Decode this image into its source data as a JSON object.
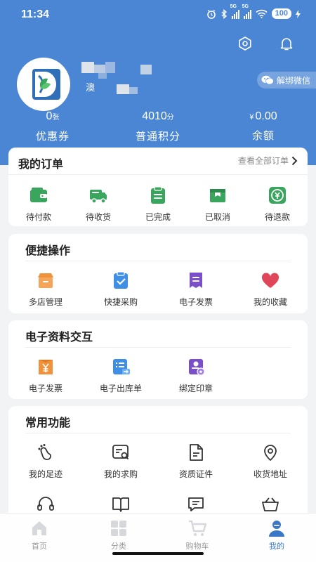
{
  "status_bar": {
    "time": "11:34",
    "battery": "100",
    "signal_1": "5G",
    "signal_2": "5G"
  },
  "header": {
    "avatar_logo_text": "D",
    "username_fragment": "澳",
    "unbind_wechat_label": "解绑微信",
    "icons": {
      "settings": "gear-icon",
      "notifications": "bell-icon"
    }
  },
  "stats": [
    {
      "value": "0",
      "unit": "张",
      "prefix": "",
      "label": "优惠券"
    },
    {
      "value": "4010",
      "unit": "分",
      "prefix": "",
      "label": "普通积分"
    },
    {
      "value": "0.00",
      "unit": "",
      "prefix": "¥",
      "label": "余额"
    }
  ],
  "orders": {
    "title": "我的订单",
    "view_all": "查看全部订单",
    "items": [
      {
        "label": "待付款",
        "icon": "wallet-icon"
      },
      {
        "label": "待收货",
        "icon": "truck-icon"
      },
      {
        "label": "已完成",
        "icon": "clipboard-check-icon"
      },
      {
        "label": "已取消",
        "icon": "cancelled-box-icon"
      },
      {
        "label": "待退款",
        "icon": "refund-icon"
      }
    ]
  },
  "quick_actions": {
    "title": "便捷操作",
    "items": [
      {
        "label": "多店管理",
        "icon": "store-icon"
      },
      {
        "label": "快捷采购",
        "icon": "purchase-check-icon"
      },
      {
        "label": "电子发票",
        "icon": "invoice-icon"
      },
      {
        "label": "我的收藏",
        "icon": "heart-icon"
      }
    ]
  },
  "e_docs": {
    "title": "电子资料交互",
    "items": [
      {
        "label": "电子发票",
        "icon": "yen-invoice-icon"
      },
      {
        "label": "电子出库单",
        "icon": "outbound-list-icon"
      },
      {
        "label": "绑定印章",
        "icon": "seal-icon"
      }
    ]
  },
  "common": {
    "title": "常用功能",
    "items": [
      {
        "label": "我的足迹",
        "icon": "footprint-icon"
      },
      {
        "label": "我的求购",
        "icon": "request-search-icon"
      },
      {
        "label": "资质证件",
        "icon": "certificate-icon"
      },
      {
        "label": "收货地址",
        "icon": "location-pin-icon"
      },
      {
        "label": "",
        "icon": "headset-icon"
      },
      {
        "label": "",
        "icon": "book-icon"
      },
      {
        "label": "",
        "icon": "message-icon"
      },
      {
        "label": "",
        "icon": "basket-icon"
      }
    ]
  },
  "bottom_nav": {
    "items": [
      {
        "label": "首页",
        "icon": "home-icon"
      },
      {
        "label": "分类",
        "icon": "category-grid-icon"
      },
      {
        "label": "购物车",
        "icon": "cart-icon"
      },
      {
        "label": "我的",
        "icon": "user-icon"
      }
    ],
    "active": "我的"
  },
  "colors": {
    "header_bg": "#4a86d4",
    "order_green": "#3aa55c",
    "orange": "#f0923a",
    "blue": "#3f8fe6",
    "purple": "#7b4fc9",
    "red": "#e0455a",
    "nav_active": "#3a77c7"
  }
}
